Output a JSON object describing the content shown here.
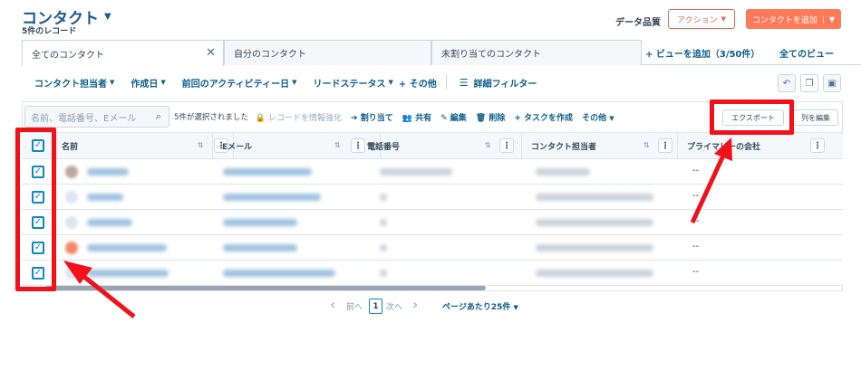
{
  "header": {
    "title": "コンタクト",
    "subtitle": "5件のレコード",
    "data_quality": "データ品質",
    "action_label": "アクション",
    "add_label": "コンタクトを追加"
  },
  "tabs": [
    {
      "label": "全てのコンタクト",
      "active": true
    },
    {
      "label": "自分のコンタクト",
      "active": false
    },
    {
      "label": "未割り当てのコンタクト",
      "active": false
    }
  ],
  "tab_links": {
    "add_view": "+ ビューを追加（3/50件）",
    "all_views": "全てのビュー"
  },
  "filters": [
    "コンタクト担当者",
    "作成日",
    "前回のアクティビティー日",
    "リードステータス"
  ],
  "filters_more": "+ その他",
  "filters_advanced": "詳細フィルター",
  "search": {
    "placeholder": "名前、電話番号、Eメール"
  },
  "bulk": {
    "selected": "5件が選択されました",
    "enrich": "レコードを情報強化",
    "assign": "割り当て",
    "share": "共有",
    "edit": "編集",
    "delete": "削除",
    "task": "タスクを作成",
    "more": "その他"
  },
  "toolbar": {
    "export": "エクスポート",
    "edit_columns": "列を編集"
  },
  "columns": [
    "名前",
    "Eメール",
    "電話番号",
    "コンタクト担当者",
    "プライマリーの会社"
  ],
  "rows": [
    {
      "company": "--"
    },
    {
      "company": "--"
    },
    {
      "company": "--"
    },
    {
      "company": "--"
    },
    {
      "company": "--"
    }
  ],
  "pager": {
    "prev": "前へ",
    "current": "1",
    "next": "次へ",
    "per_page": "ページあたり25件"
  },
  "colors": {
    "accent": "#ff7a59",
    "link": "#0b5e8a",
    "checkbox": "#0b8ac2",
    "highlight": "#f2101a"
  }
}
